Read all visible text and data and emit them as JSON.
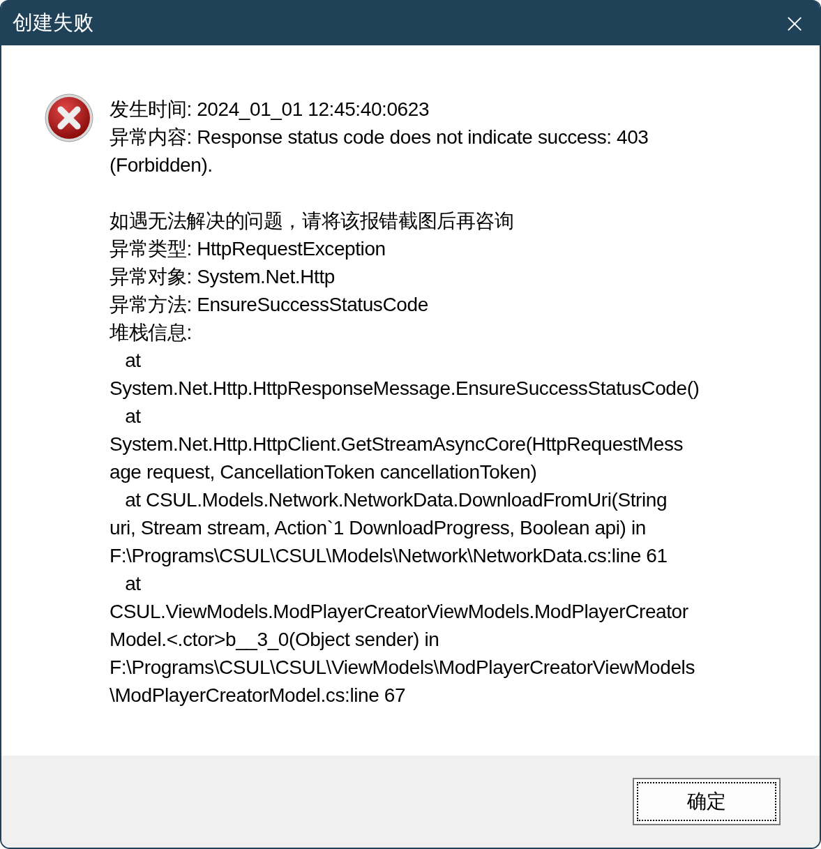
{
  "window": {
    "title": "创建失败",
    "close": "×"
  },
  "message": {
    "blocks": [
      [
        "发生时间: 2024_01_01 12:45:40:0623",
        "异常内容: Response status code does not indicate success: 403",
        "(Forbidden)."
      ],
      [
        "如遇无法解决的问题，请将该报错截图后再咨询",
        "异常类型: HttpRequestException",
        "异常对象: System.Net.Http",
        "异常方法: EnsureSuccessStatusCode",
        "堆栈信息:",
        "   at",
        "System.Net.Http.HttpResponseMessage.EnsureSuccessStatusCode()",
        "   at",
        "System.Net.Http.HttpClient.GetStreamAsyncCore(HttpRequestMess",
        "age request, CancellationToken cancellationToken)",
        "   at CSUL.Models.Network.NetworkData.DownloadFromUri(String",
        "uri, Stream stream, Action`1 DownloadProgress, Boolean api) in",
        "F:\\Programs\\CSUL\\CSUL\\Models\\Network\\NetworkData.cs:line 61",
        "   at",
        "CSUL.ViewModels.ModPlayerCreatorViewModels.ModPlayerCreator",
        "Model.<.ctor>b__3_0(Object sender) in",
        "F:\\Programs\\CSUL\\CSUL\\ViewModels\\ModPlayerCreatorViewModels",
        "\\ModPlayerCreatorModel.cs:line 67"
      ]
    ]
  },
  "buttons": [
    {
      "label": "确定",
      "focused": true
    }
  ]
}
